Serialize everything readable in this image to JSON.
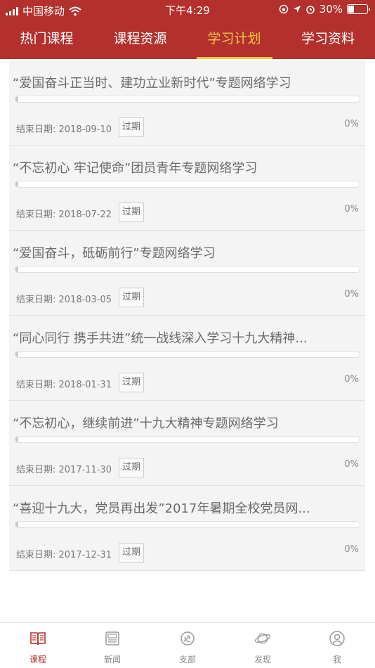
{
  "status_bar": {
    "carrier": "中国移动",
    "time": "下午4:29",
    "battery_percent": "30%",
    "battery_level": 0.3
  },
  "tabs": [
    {
      "label": "热门课程",
      "active": false
    },
    {
      "label": "课程资源",
      "active": false
    },
    {
      "label": "学习计划",
      "active": true
    },
    {
      "label": "学习资料",
      "active": false
    }
  ],
  "colors": {
    "header_bg": "#b3302c",
    "active_tab": "#f3c744",
    "nav_active": "#b3302c"
  },
  "plans": [
    {
      "title": "“爱国奋斗正当时、建功立业新时代”专题网络学习",
      "date_label": "结束日期: 2018-09-10",
      "status": "过期",
      "progress": "0%"
    },
    {
      "title": "“不忘初心 牢记使命”团员青年专题网络学习",
      "date_label": "结束日期: 2018-07-22",
      "status": "过期",
      "progress": "0%"
    },
    {
      "title": "“爱国奋斗，砥砺前行”专题网络学习",
      "date_label": "结束日期: 2018-03-05",
      "status": "过期",
      "progress": "0%"
    },
    {
      "title": "“同心同行 携手共进”统一战线深入学习十九大精神...",
      "date_label": "结束日期: 2018-01-31",
      "status": "过期",
      "progress": "0%"
    },
    {
      "title": "“不忘初心，继续前进”十九大精神专题网络学习",
      "date_label": "结束日期: 2017-11-30",
      "status": "过期",
      "progress": "0%"
    },
    {
      "title": "“喜迎十九大，党员再出发”2017年暑期全校党员网...",
      "date_label": "结束日期: 2017-12-31",
      "status": "过期",
      "progress": "0%"
    }
  ],
  "bottom_nav": [
    {
      "label": "课程",
      "icon": "book-icon",
      "active": true
    },
    {
      "label": "新闻",
      "icon": "newspaper-icon",
      "active": false
    },
    {
      "label": "支部",
      "icon": "party-emblem-icon",
      "active": false
    },
    {
      "label": "发现",
      "icon": "planet-icon",
      "active": false
    },
    {
      "label": "我",
      "icon": "user-icon",
      "active": false
    }
  ]
}
